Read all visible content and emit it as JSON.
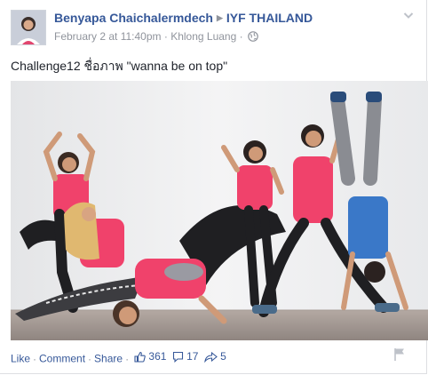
{
  "post": {
    "author": "Benyapa Chaichalermdech",
    "group": "IYF THAILAND",
    "timestamp": "February 2 at 11:40pm",
    "location": "Khlong Luang",
    "meta_sep": "·",
    "message": "Challenge12 ชื่อภาพ \"wanna be on top\""
  },
  "actions": {
    "like": "Like",
    "comment": "Comment",
    "share": "Share",
    "dot": "·"
  },
  "stats": {
    "likes": "361",
    "comments": "17",
    "shares": "5"
  },
  "icons": {
    "avatar": "profile-photo",
    "chevron": "chevron-down-icon",
    "globe": "globe-icon",
    "like": "thumbs-up-icon",
    "comment": "comment-icon",
    "share": "share-arrow-icon",
    "flag": "flag-icon"
  },
  "colors": {
    "link": "#365899",
    "meta": "#90949c",
    "text": "#1d2129",
    "shirt_pink": "#f0426b"
  }
}
